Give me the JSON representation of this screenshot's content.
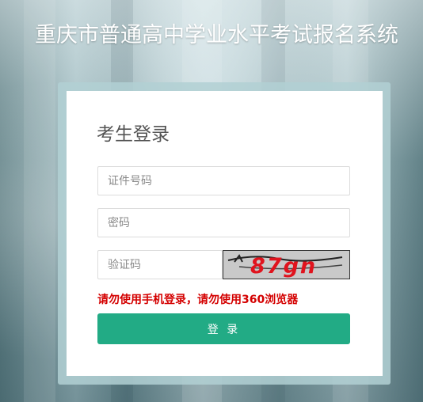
{
  "header": {
    "title": "重庆市普通高中学业水平考试报名系统"
  },
  "login": {
    "title": "考生登录",
    "id_placeholder": "证件号码",
    "password_placeholder": "密码",
    "captcha_placeholder": "验证码",
    "captcha_text": "87gn",
    "warning": "请勿使用手机登录，请勿使用360浏览器",
    "submit_label": "登 录"
  },
  "colors": {
    "button": "#22ab85",
    "warning": "#d40000",
    "captcha_text": "#e0141e"
  }
}
